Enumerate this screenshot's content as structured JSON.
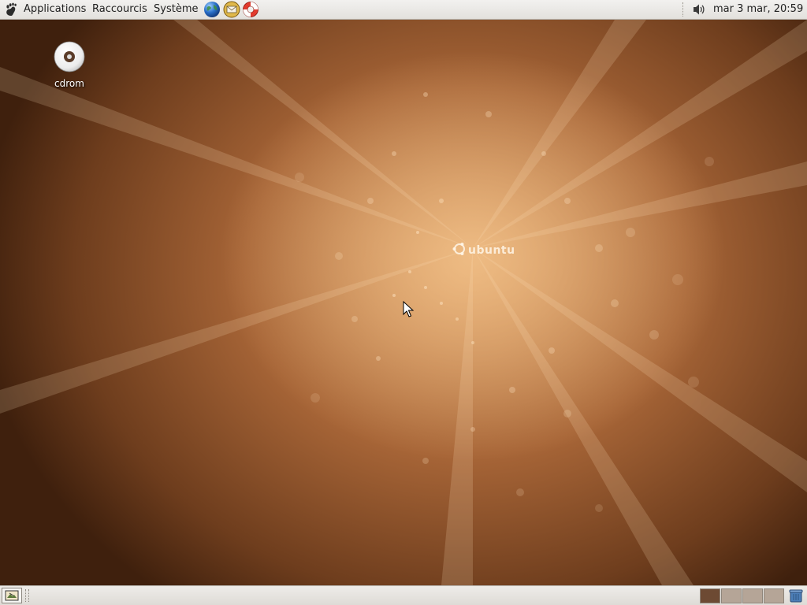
{
  "top_panel": {
    "menus": [
      "Applications",
      "Raccourcis",
      "Système"
    ],
    "launchers": [
      "browser-globe-icon",
      "mail-client-icon",
      "help-lifebuoy-icon"
    ],
    "clock": "mar  3 mar, 20:59"
  },
  "desktop": {
    "icons": [
      {
        "label": "cdrom",
        "icon": "cdrom-disc-icon"
      }
    ],
    "wallpaper_brand": "ubuntu"
  },
  "bottom_panel": {
    "workspace_count": 4,
    "active_workspace": 1
  },
  "colors": {
    "panel_bg": "#eceae6",
    "wallpaper_center": "#f4c48c",
    "wallpaper_edge": "#3f200d",
    "workspace_active": "#6d4a33",
    "workspace_inactive": "#b5a597"
  }
}
